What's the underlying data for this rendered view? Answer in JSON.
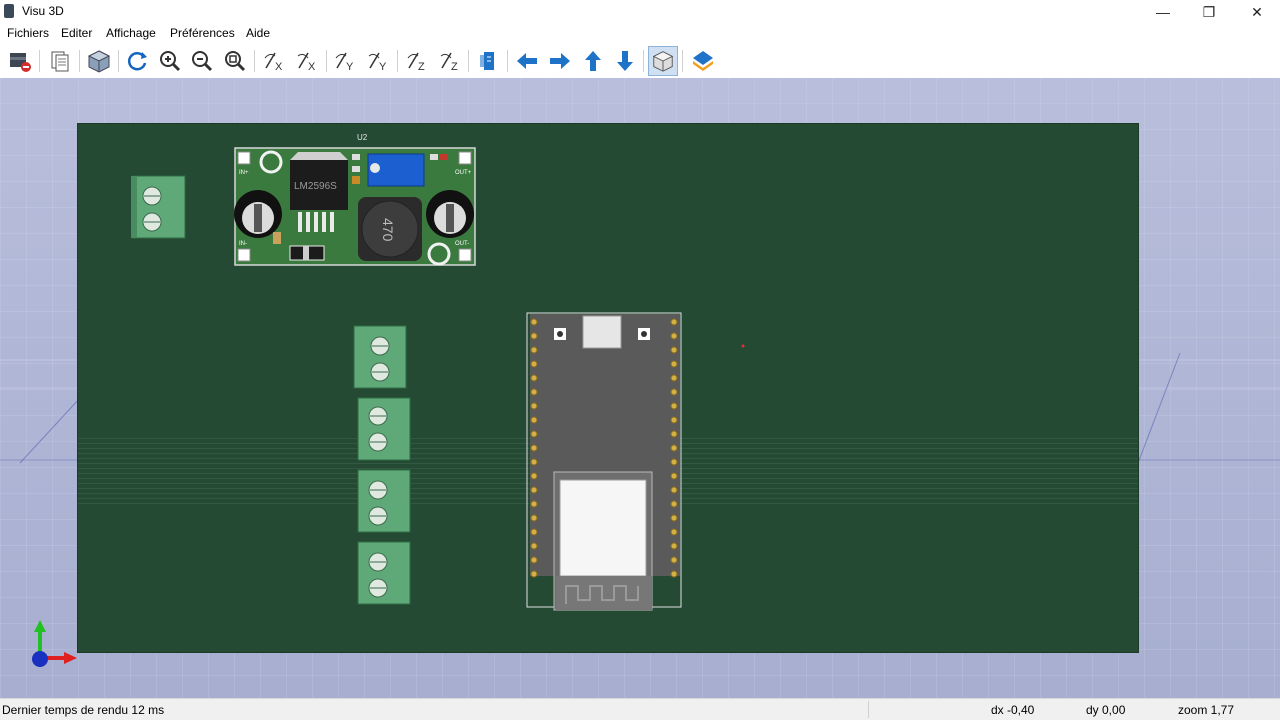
{
  "window": {
    "title": "Visu 3D",
    "buttons": {
      "minimize": "—",
      "maximize": "❐",
      "close": "✕"
    }
  },
  "menu": [
    "Fichiers",
    "Editer",
    "Affichage",
    "Préférences",
    "Aide"
  ],
  "toolbar": {
    "buttons": [
      "exit-icon",
      "copy-icon",
      "3d-view-icon",
      "refresh-icon",
      "zoom-in-icon",
      "zoom-out-icon",
      "zoom-fit-icon",
      "rotate-x-icon",
      "rotate-x-rev-icon",
      "rotate-y-icon",
      "rotate-y-rev-icon",
      "rotate-z-icon",
      "rotate-z-rev-icon",
      "flip-board-icon",
      "arrow-left-icon",
      "arrow-right-icon",
      "arrow-up-icon",
      "arrow-down-icon",
      "orthographic-icon",
      "layers-icon"
    ]
  },
  "board": {
    "module_ref": "U2",
    "module_chip": "LM2596S",
    "inductor": "470",
    "pad_labels": {
      "in_plus": "IN+",
      "in_minus": "IN-",
      "out_plus": "OUT+",
      "out_minus": "OUT-"
    }
  },
  "status": {
    "render_time": "Dernier temps de rendu 12 ms",
    "dx": "dx -0,40",
    "dy": "dy 0,00",
    "zoom": "zoom 1,77"
  },
  "colors": {
    "board": "#254a33",
    "terminal": "#5fa878",
    "module_pcb": "#3a7a3e",
    "esp_pcb": "#5a5a5a"
  }
}
